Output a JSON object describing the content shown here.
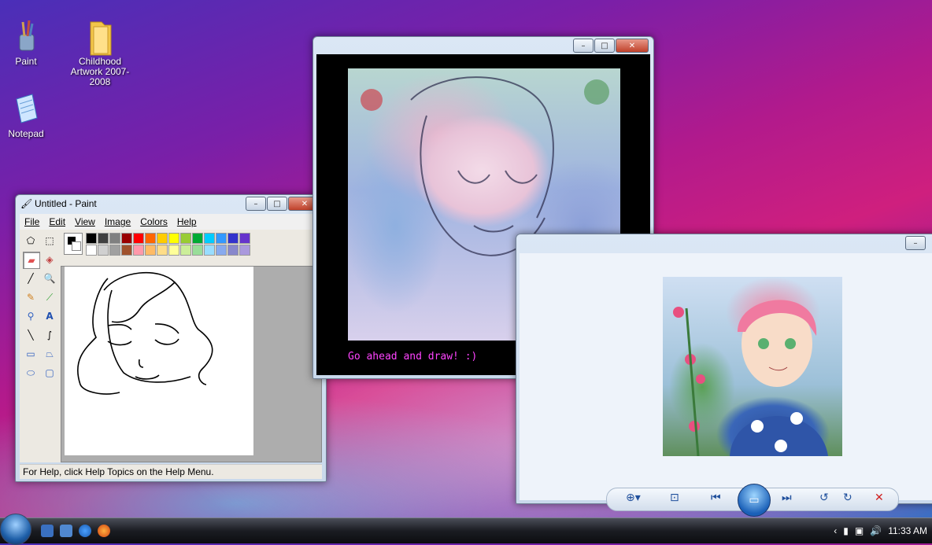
{
  "desktop": {
    "icons": [
      {
        "label": "Paint",
        "icon": "paint-icon"
      },
      {
        "label": "Childhood Artwork 2007-2008",
        "icon": "folder-icon"
      },
      {
        "label": "Notepad",
        "icon": "notepad-icon"
      }
    ]
  },
  "paint": {
    "title": "Untitled - Paint",
    "menu": [
      "File",
      "Edit",
      "View",
      "Image",
      "Colors",
      "Help"
    ],
    "status": "For Help, click Help Topics on the Help Menu.",
    "palette_top": [
      "#000000",
      "#404040",
      "#808080",
      "#990000",
      "#ff0000",
      "#ff6600",
      "#ffcc00",
      "#ffff00",
      "#99cc33",
      "#00aa33",
      "#00ccff",
      "#3399ff",
      "#3333cc",
      "#6633cc"
    ],
    "palette_bottom": [
      "#ffffff",
      "#d0d0d0",
      "#a0a0a0",
      "#a0522d",
      "#ff99aa",
      "#ffbb66",
      "#ffdd88",
      "#ffff99",
      "#ccee99",
      "#99dd99",
      "#99ddff",
      "#88aaee",
      "#8888cc",
      "#aa99dd"
    ]
  },
  "drawing_app": {
    "caption": "Go ahead and draw! :)"
  },
  "photo_viewer": {
    "controls": [
      "zoom-icon",
      "fit-icon",
      "previous-icon",
      "slideshow-icon",
      "next-icon",
      "rotate-left-icon",
      "rotate-right-icon",
      "delete-icon"
    ]
  },
  "taskbar": {
    "clock": "11:33 AM"
  }
}
